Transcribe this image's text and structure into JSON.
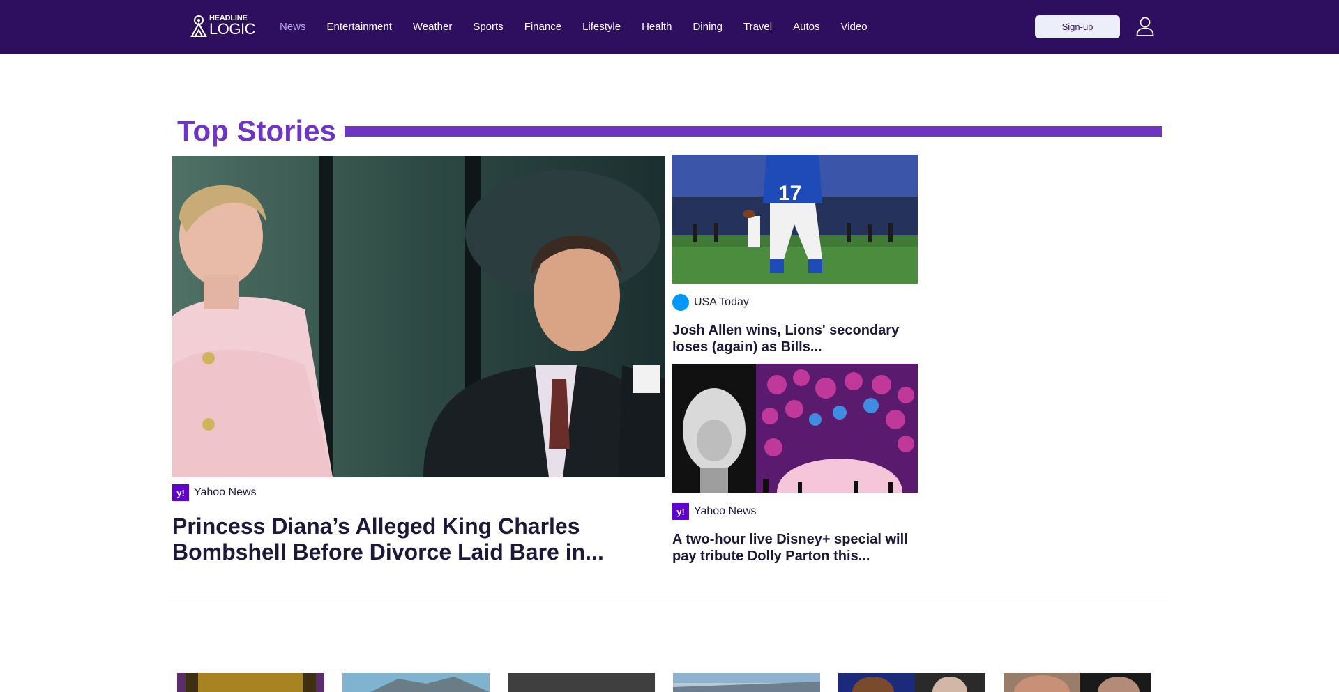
{
  "header": {
    "logo": {
      "line1": "HEADLINE",
      "line2": "LOGIC"
    },
    "nav": [
      {
        "label": "News",
        "active": true
      },
      {
        "label": "Entertainment"
      },
      {
        "label": "Weather"
      },
      {
        "label": "Sports"
      },
      {
        "label": "Finance"
      },
      {
        "label": "Lifestyle"
      },
      {
        "label": "Health"
      },
      {
        "label": "Dining"
      },
      {
        "label": "Travel"
      },
      {
        "label": "Autos"
      },
      {
        "label": "Video"
      }
    ],
    "signup_label": "Sign-up",
    "user_icon": "user-icon"
  },
  "top_stories": {
    "title": "Top Stories",
    "main": {
      "source": "Yahoo News",
      "headline": "Princess Diana’s Alleged King Charles Bombshell Before Divorce Laid Bare in..."
    },
    "side": [
      {
        "source": "USA Today",
        "headline": "Josh Allen wins, Lions' secondary loses (again) as Bills..."
      },
      {
        "source": "Yahoo News",
        "headline": "A two-hour live Disney+ special will pay tribute Dolly Parton this..."
      }
    ]
  },
  "colors": {
    "header_bg": "#2e0f5f",
    "accent": "#6e35c3",
    "nav_active": "#b9a8ee",
    "signup_bg": "#eceef9"
  }
}
